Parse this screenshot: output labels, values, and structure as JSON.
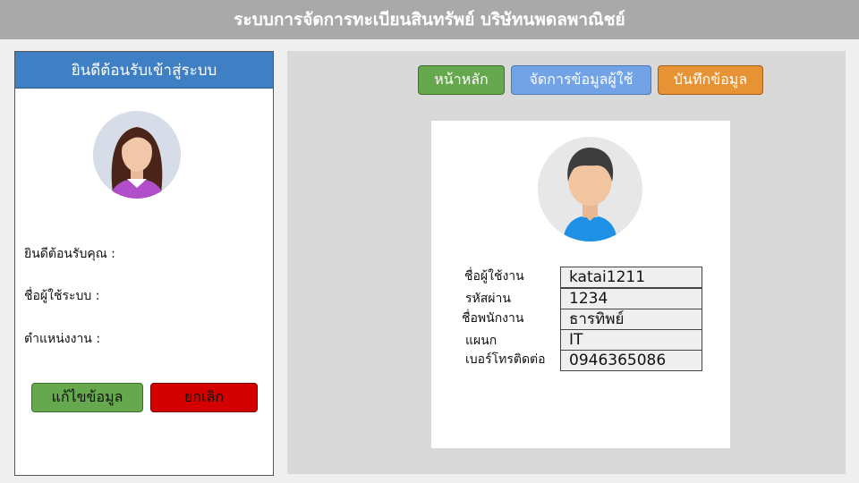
{
  "app": {
    "title": "ระบบการจัดการทะเบียนสินทรัพย์ บริษัทนพดลพาณิชย์"
  },
  "sidebar": {
    "header": "ยินดีต้อนรับเข้าสู่ระบบ",
    "welcome_label": "ยินดีต้อนรับคุณ :",
    "username_label": "ชื่อผู้ใช้ระบบ :",
    "position_label": "ตำแหน่งงาน :",
    "edit_button": "แก้ไขข้อมูล",
    "cancel_button": "ยกเลิก",
    "avatar_icon": "female-user-avatar-icon"
  },
  "nav": {
    "home": "หน้าหลัก",
    "manage_users": "จัดการข้อมูลผู้ใช้",
    "save": "บันทึกข้อมูล"
  },
  "profile": {
    "avatar_icon": "male-user-avatar-icon",
    "fields": [
      {
        "label": "ชื่อผู้ใช้งาน",
        "value": "katai1211"
      },
      {
        "label": "รหัสผ่าน",
        "value": "1234"
      },
      {
        "label": "ชื่อพนักงาน",
        "value": "ธารทิพย์"
      },
      {
        "label": "แผนก",
        "value": "IT"
      },
      {
        "label": "เบอร์โทรติดต่อ",
        "value": "0946365086"
      }
    ]
  },
  "colors": {
    "title_bar": "#a9a9a9",
    "sidebar_header": "#3f7fc4",
    "green": "#66a84d",
    "red": "#d40000",
    "blue": "#72a3e6",
    "orange": "#e79234"
  }
}
